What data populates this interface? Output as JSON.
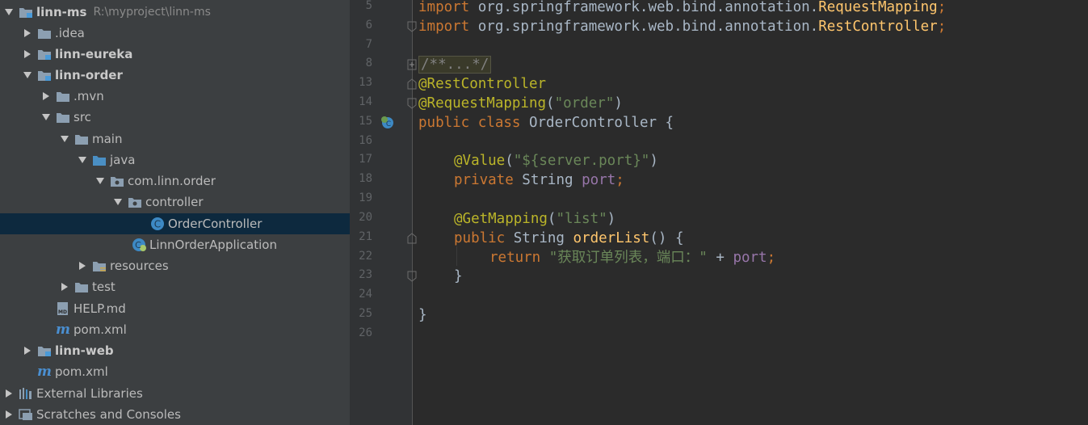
{
  "project_tree": {
    "root": {
      "name": "linn-ms",
      "path": "R:\\myproject\\linn-ms"
    },
    "items": [
      {
        "label": ".idea"
      },
      {
        "label": "linn-eureka"
      },
      {
        "label": "linn-order"
      },
      {
        "label": ".mvn"
      },
      {
        "label": "src"
      },
      {
        "label": "main"
      },
      {
        "label": "java"
      },
      {
        "label": "com.linn.order"
      },
      {
        "label": "controller"
      },
      {
        "label": "OrderController"
      },
      {
        "label": "LinnOrderApplication"
      },
      {
        "label": "resources"
      },
      {
        "label": "test"
      },
      {
        "label": "HELP.md"
      },
      {
        "label": "pom.xml"
      },
      {
        "label": "linn-web"
      },
      {
        "label": "pom.xml"
      },
      {
        "label": "External Libraries"
      },
      {
        "label": "Scratches and Consoles"
      }
    ],
    "icon_glyphs": {
      "class_icon": "C",
      "maven_icon": "m",
      "markdown_icon": "MD"
    }
  },
  "editor": {
    "line_numbers": [
      "5",
      "6",
      "7",
      "8",
      "13",
      "14",
      "15",
      "16",
      "17",
      "18",
      "19",
      "20",
      "21",
      "22",
      "23",
      "24",
      "25",
      "26"
    ],
    "code": {
      "l5": {
        "t1": "import",
        "t2": " org.springframework.web.bind.annotation.",
        "t3": "RequestMapping",
        "t4": ";"
      },
      "l6": {
        "t1": "import",
        "t2": " org.springframework.web.bind.annotation.",
        "t3": "RestController",
        "t4": ";"
      },
      "l8": {
        "t1": "/**...*/"
      },
      "l13": {
        "t1": "@RestController"
      },
      "l14": {
        "t1": "@RequestMapping",
        "t2": "(",
        "t3": "\"order\"",
        "t4": ")"
      },
      "l15": {
        "t1": "public class",
        "t2": " OrderController {"
      },
      "l17": {
        "t1": "@Value",
        "t2": "(",
        "t3": "\"${server.port}\"",
        "t4": ")"
      },
      "l18": {
        "t1": "private",
        "t2": " String ",
        "t3": "port",
        "t4": ";"
      },
      "l20": {
        "t1": "@GetMapping",
        "t2": "(",
        "t3": "\"list\"",
        "t4": ")"
      },
      "l21": {
        "t1": "public",
        "t2": " String ",
        "t3": "orderList",
        "t4": "() {"
      },
      "l22": {
        "t1": "return",
        "t2": " ",
        "t3": "\"获取订单列表，端口：\"",
        "t4": " + ",
        "t5": "port",
        "t6": ";"
      },
      "l23": {
        "t1": "}"
      },
      "l25": {
        "t1": "}"
      }
    }
  },
  "colors": {
    "tree_bg": "#3c3f41",
    "editor_bg": "#2b2b2b",
    "selection": "#0d293e",
    "keyword": "#cc7832",
    "annotation": "#bbb529",
    "string": "#6a8759",
    "field": "#9876aa",
    "method": "#ffc66d",
    "text": "#a9b7c6"
  }
}
